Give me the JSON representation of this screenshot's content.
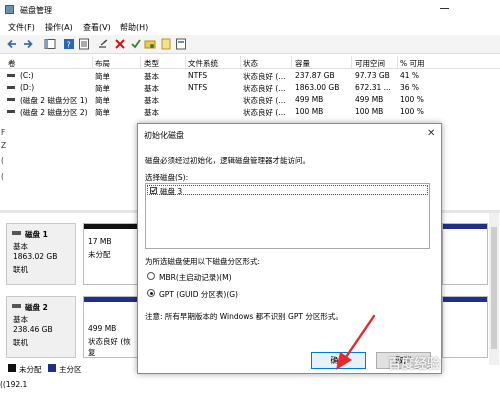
{
  "window": {
    "title": "磁盘管理"
  },
  "menu": [
    "文件(F)",
    "操作(A)",
    "查看(V)",
    "帮助(H)"
  ],
  "volume_table": {
    "columns": [
      "卷",
      "布局",
      "类型",
      "文件系统",
      "状态",
      "容量",
      "可用空间",
      "% 可用"
    ],
    "rows": [
      [
        "(C:)",
        "简单",
        "基本",
        "NTFS",
        "状态良好 (...",
        "237.87 GB",
        "97.73 GB",
        "41 %"
      ],
      [
        "(D:)",
        "简单",
        "基本",
        "NTFS",
        "状态良好 (...",
        "1863.00 GB",
        "672.31 ...",
        "36 %"
      ],
      [
        "(磁盘 2 磁盘分区 1)",
        "简单",
        "基本",
        "",
        "状态良好 (...",
        "499 MB",
        "499 MB",
        "100 %"
      ],
      [
        "(磁盘 2 磁盘分区 2)",
        "简单",
        "基本",
        "",
        "状态良好 (...",
        "100 MB",
        "100 MB",
        "100 %"
      ]
    ]
  },
  "left_clipped": [
    "F",
    "Z",
    "(",
    "("
  ],
  "disk_map": {
    "disk1": {
      "name": "磁盘 1",
      "type": "基本",
      "size": "1863.02 GB",
      "status": "联机",
      "part_size": "17 MB",
      "part_status": "未分配"
    },
    "disk2": {
      "name": "磁盘 2",
      "type": "基本",
      "size": "238.46 GB",
      "status": "联机",
      "part_size": "499 MB",
      "part_status": "状态良好 (恢复"
    }
  },
  "legend": {
    "unallocated": "未分配",
    "primary": "主分区"
  },
  "bottom_clip": "((192.1",
  "dialog": {
    "title": "初始化磁盘",
    "message": "磁盘必须经过初始化，逻辑磁盘管理器才能访问。",
    "select_label": "选择磁盘(S):",
    "disks": [
      "磁盘 3"
    ],
    "style_label": "为所选磁盘使用以下磁盘分区形式:",
    "options": [
      "MBR(主启动记录)(M)",
      "GPT (GUID 分区表)(G)"
    ],
    "selected_option": 1,
    "note": "注意: 所有早期版本的 Windows 都不识别 GPT 分区形式。",
    "ok": "确定",
    "cancel": "取消"
  },
  "watermark": "百度经验",
  "colors": {
    "accent": "#0078d7",
    "primary_partition": "#1f2f8a",
    "unallocated": "#111111",
    "arrow": "#e8282b"
  }
}
